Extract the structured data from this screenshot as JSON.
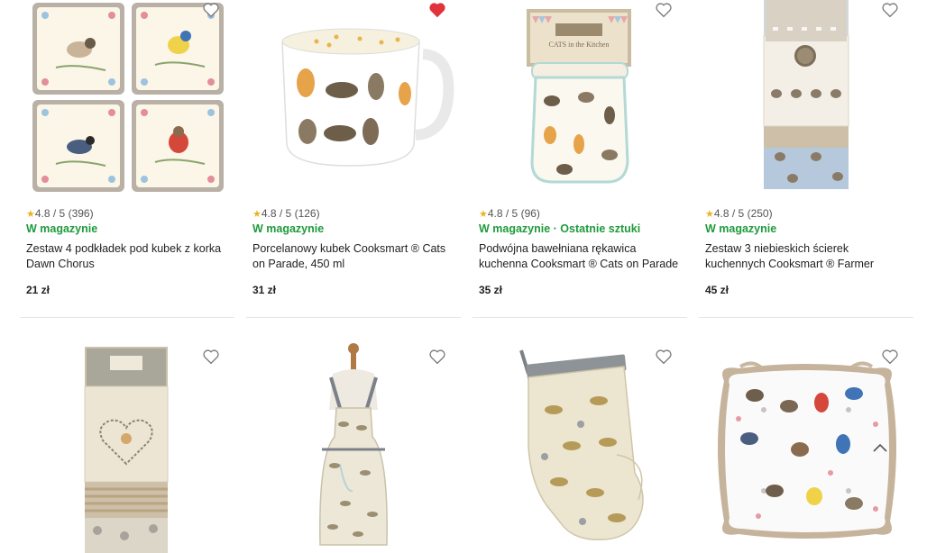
{
  "products": [
    {
      "rating": "4.8 / 5",
      "reviews": "(396)",
      "stock": "W magazynie",
      "name": "Zestaw 4 podkładek pod kubek z korka Dawn Chorus",
      "price": "21 zł",
      "favorite": false,
      "image": "coasters-birds"
    },
    {
      "rating": "4.8 / 5",
      "reviews": "(126)",
      "stock": "W magazynie",
      "name": "Porcelanowy kubek Cooksmart ® Cats on Parade, 450 ml",
      "price": "31 zł",
      "favorite": true,
      "image": "mug-cats"
    },
    {
      "rating": "4.8 / 5",
      "reviews": "(96)",
      "stock": "W magazynie · Ostatnie sztuki",
      "name": "Podwójna bawełniana rękawica kuchenna Cooksmart ® Cats on Parade",
      "price": "35 zł",
      "favorite": false,
      "image": "double-oven-glove-cats"
    },
    {
      "rating": "4.8 / 5",
      "reviews": "(250)",
      "stock": "W magazynie",
      "name": "Zestaw 3 niebieskich ścierek kuchennych Cooksmart ® Farmer",
      "price": "45 zł",
      "favorite": false,
      "image": "tea-towels-hens"
    },
    {
      "favorite": false,
      "image": "tea-towels-heart"
    },
    {
      "favorite": false,
      "image": "apron-hares"
    },
    {
      "favorite": false,
      "image": "oven-mitt-hares"
    },
    {
      "favorite": false,
      "image": "seat-cushion-birds"
    }
  ],
  "colors": {
    "in_stock": "#1f9a3c",
    "star": "#e8b51f",
    "favorite_active": "#e0333c",
    "favorite_inactive": "#777777"
  }
}
